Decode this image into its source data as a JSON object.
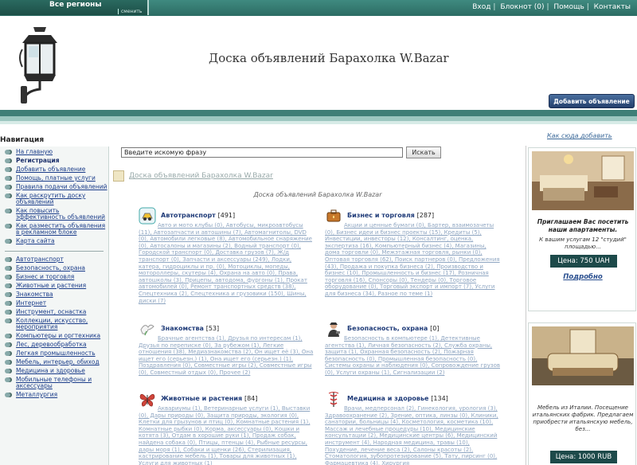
{
  "top": {
    "region": "Все регионы",
    "change": "сменить",
    "links": [
      "Вход",
      "Блокнот (0)",
      "Помощь",
      "Контакты"
    ]
  },
  "header": {
    "title": "Доска объявлений Барахолка W.Bazar",
    "add_button": "Добавить объявление"
  },
  "howto": "Как сюда добавить",
  "search": {
    "value": "Введите искомую фразу",
    "button": "Искать"
  },
  "nav": {
    "heading": "Навигация",
    "links": [
      "На главную",
      "Регистрация",
      "Добавить объявление",
      "Помощь, платные услуги",
      "Правила подачи объявлений",
      "Как раскрутить доску объявлений",
      "Как повысить эффективность объявлений",
      "Как разместить объявления в рекламном блоке",
      "Карта сайта"
    ],
    "categories": [
      "Автотранспорт",
      "Безопасность, охрана",
      "Бизнес и торговля",
      "Животные и растения",
      "Знакомства",
      "Интернет",
      "Инструмент, оснастка",
      "Коллекции, искусство, мероприятия",
      "Компьютеры и оргтехника",
      "Лес, деревообработка",
      "Легкая промышленность",
      "Мебель, интерьер, обиход",
      "Медицина и здоровье",
      "Мобильные телефоны и аксессуары",
      "Металлургия"
    ]
  },
  "main": {
    "breadcrumb": "Доска объявлений Барахолка W.Bazar",
    "subtitle": "Доска объявлений Барахолка W.Bazar",
    "categories": [
      {
        "name": "Автотранспорт",
        "count": "[491]",
        "subs": "Авто и мото клубы (0), Автобусы, микроавтобусы (11), Автозапчасти и автошины (7), Автомагнитолы, DVD (0), Автомобили легковые (8), Автомобильное снаряжение (0), Автосалоны и магазины (2), Водный транспорт (0), Городской транспорт (0), Доставка грузов (7), Ж/д транспорт (0), Запчасти и аксессуары (249), Лодки, катера, гидроциклы и пр. (0), Мотоциклы, мопеды, мотороллеры, скутеры (4), Охрана на авто (0), Права, автошколы (3), Прицепы, автодома, фургоны (1), Прокат автомобилей (0), Ремонт транспортных средств (38), Спецтехника (2), Спецтехника и грузовики (150), Шины, диски (7)"
      },
      {
        "name": "Бизнес и торговля",
        "count": "[287]",
        "subs": "Акции и ценные бумаги (0), Бартер, взаимозачеты (0), Бизнес идеи и бизнес проекты (15), Кредиты (5), Инвестиции, инвесторы (12), Консалтинг, оценка, экспертиза (16), Компьютерный бизнес (4), Магазины, дома торговли (0), Межэтажная торговля, рынки (0), Оптовая торговля (62), Поиск партнеров (0), Предложения (43), Продажа и покупка бизнеса (2), Производство и бизнес (10), Промышленность и бизнес (17), Розничная торговля (16), Спонсоры (0), Тендеры (0), Торговое оборудование (0), Торговый экспорт и импорт (7), Услуги для бизнеса (34), Разное по теме (1)"
      },
      {
        "name": "Знакомства",
        "count": "[53]",
        "subs": "Брачные агентства (1), Друзья по интересам (1), Друзья по переписке (0), За рубежом (1), Легкие отношения (38), Медиазнакомства (2), Он ищет её (3), Она ищет его (серьезн.) (1), Она ищет его (серьезн.) (1), Поздравления (0), Совместные игры (2), Совместные игры (0), Совместный отдых (0), Прочее (2)"
      },
      {
        "name": "Безопасность, охрана",
        "count": "[0]",
        "subs": "Безопасность в компьютере (1), Детективные агентства (1), Личная безопасность (2), Служба охраны, защита (1), Охранная безопасность (2), Пожарная безопасность (0), Промышленная безопасность (0), Системы охраны и наблюдения (0), Сопровождение грузов (0), Услуги охраны (1), Сигнализации (2)"
      },
      {
        "name": "Животные и растения",
        "count": "[84]",
        "subs": "Аквариумы (1), Ветеринарные услуги (1), Выставки (0), Дары природы (0), Защита природы, экология (0), Клетки для грызунов и птиц (0), Комнатные растения (1), Комнатные рыбки (0), Корма, аксессуары (0), Кошки и котята (3), Отдам в хорошие руки (1), Продаж собак, найдена собака (0), Птицы, птенцы (4), Рыбные ресурсы, дары моря (1), Собаки и щенки (26), Стерилизация, кастрирование мебель (1), Товары для животных (1), Услуги для животных (1)"
      },
      {
        "name": "Медицина и здоровье",
        "count": "[134]",
        "subs": "Врачи, медперсонал (2), Гинекология, урология (3), Здравоохранение (2), Зрение, оптика, линзы (0), Клиники, санатории, больницы (4), Косметология, косметика (10), Массаж и лечебные процедуры (10), Медицинские консультации (2), Медицинские центры (6), Медицинский инструмент (4), Народная медицина, травы (10), Похудение, лечение веса (2), Салоны красоты (2), Стоматология, зубопротезирование (5), Тату, пирсинг (0), Фармацевтика (4), Хирургия"
      }
    ]
  },
  "ads": [
    {
      "head": "Приглашаем Вас посетить наши апартаменты.",
      "desc": "К вашим услугам 12 \"студий\" площадью...",
      "price": "Цена: 750 UAH",
      "more": "Подробно"
    },
    {
      "head": "",
      "desc": "Мебель из Италии. Посещение итальянских фабрик. Предлагаем приобрести итальянскую мебель, без...",
      "price": "Цена: 1000 RUB",
      "more": ""
    }
  ],
  "colors": {
    "topbar": "#2f7369",
    "button": "#2a4775",
    "price": "#1d4a4a",
    "nav_link": "#1b3d8a"
  }
}
